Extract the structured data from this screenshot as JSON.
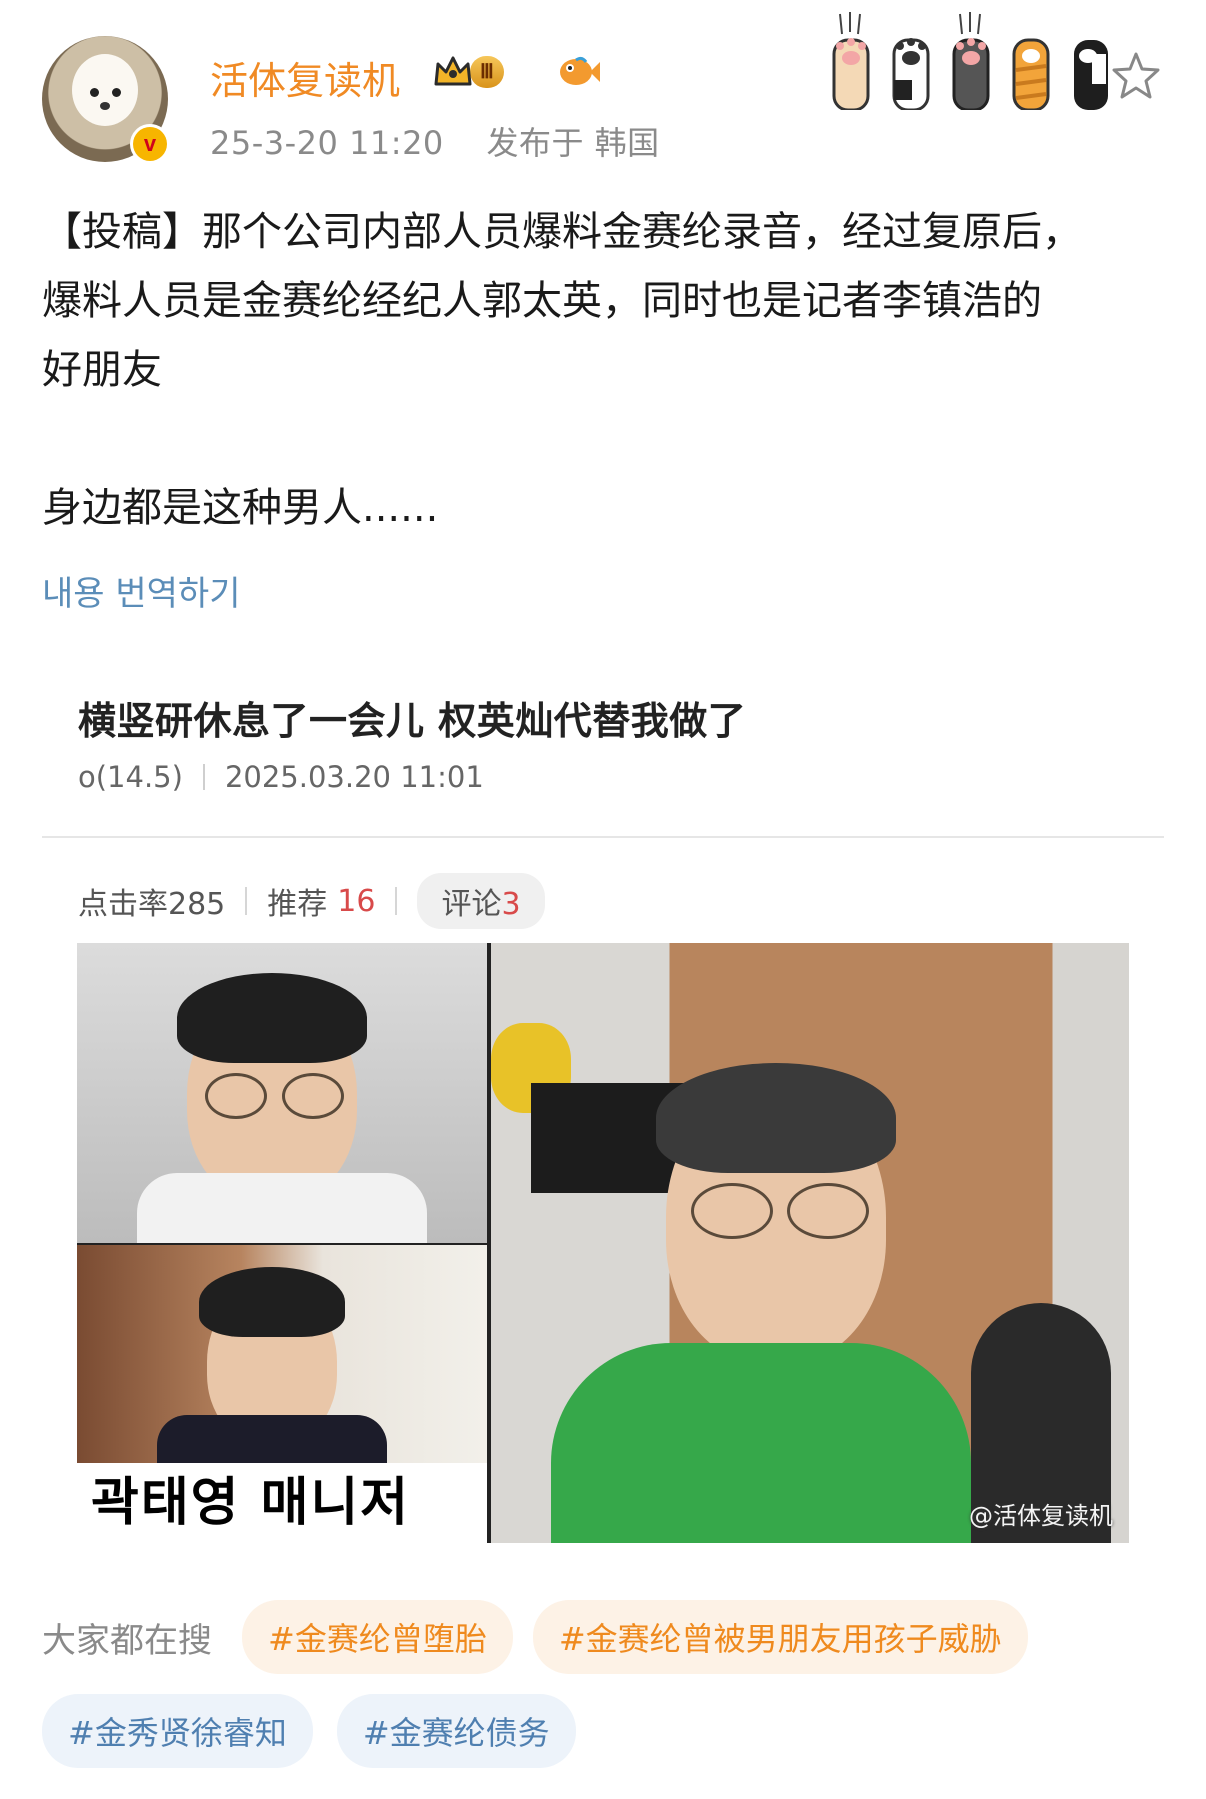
{
  "post": {
    "username": "活体复读机",
    "badge_level": "Ⅲ",
    "verified_mark": "v",
    "timestamp": "25-3-20 11:20",
    "location": "发布于 韩国",
    "lines": [
      "【投稿】那个公司内部人员爆料金赛纶录音，经过复原后，",
      "爆料人员是金赛纶经纪人郭太英，同时也是记者李镇浩的",
      "好朋友"
    ],
    "line_after_gap": "身边都是这种男人......",
    "translate_link": "내용 번역하기"
  },
  "icons": {
    "avatar": "dog-avatar",
    "verified": "verified-badge-icon",
    "crown": "crown-icon",
    "fish": "fish-icon",
    "paws": [
      "cat-paw-icon",
      "cat-paw-icon",
      "cat-paw-icon",
      "cat-paw-icon",
      "cat-paw-icon"
    ],
    "star": "star-icon"
  },
  "card": {
    "title": "横竖研休息了一会儿 权英灿代替我做了",
    "author": "o(14.5)",
    "date": "2025.03.20 11:01",
    "stats": {
      "clicks_label": "点击率285",
      "recommend_label": "推荐",
      "recommend_count": "16",
      "comments_label": "评论",
      "comments_count": "3"
    },
    "image_caption": "곽태영 매니저",
    "watermark": "@活体复读机"
  },
  "search": {
    "label": "大家都在搜",
    "tags": [
      "#金赛纶曾堕胎",
      "#金赛纶曾被男朋友用孩子威胁"
    ],
    "tags_row2": [
      "#金秀贤徐睿知",
      "#金赛纶债务"
    ]
  },
  "colors": {
    "username": "#f08a24",
    "meta": "#8a8a8a",
    "link": "#5b8db8",
    "tag_orange": "#ef8a1e",
    "tag_blue": "#4f7fb0"
  }
}
